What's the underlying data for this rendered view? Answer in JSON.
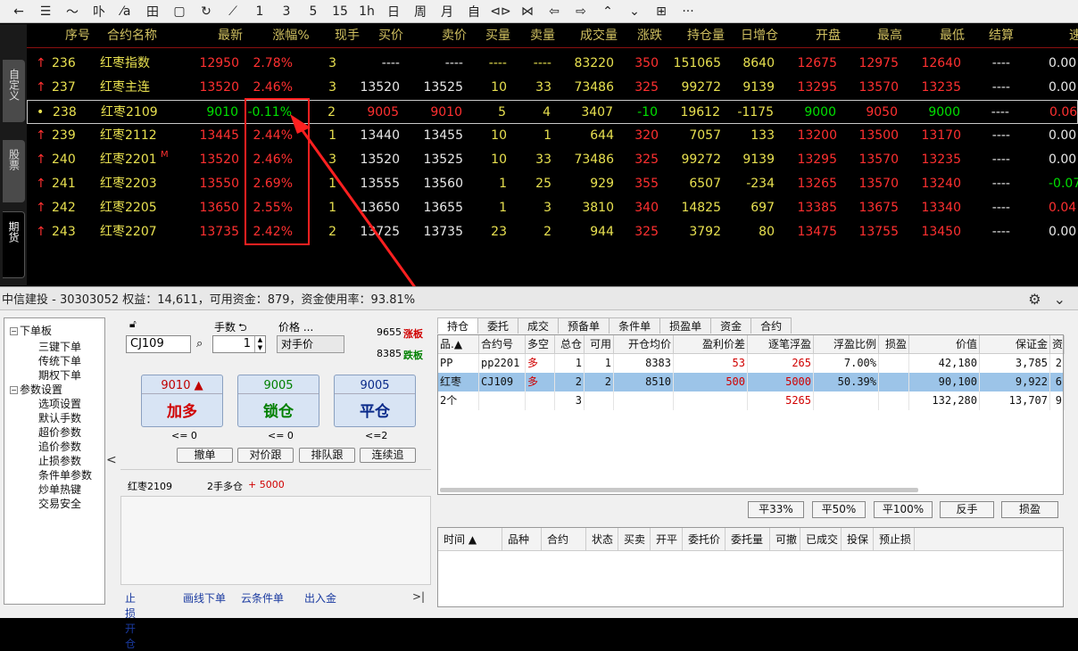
{
  "toolbar": {
    "items": [
      "←",
      "☰",
      "〜",
      "卟",
      "⁄a",
      "田",
      "▢",
      "↻",
      "⟋",
      "1",
      "3",
      "5",
      "15",
      "1h",
      "日",
      "周",
      "月",
      "自",
      "⊲⊳",
      "⋈",
      "⇦",
      "⇨",
      "⌃",
      "⌄",
      "⊞",
      "···"
    ]
  },
  "side_tabs": [
    "自定义",
    "股票",
    "期货"
  ],
  "quote": {
    "headers": [
      "序号",
      "合约名称",
      "最新",
      "涨幅%",
      "现手",
      "买价",
      "卖价",
      "买量",
      "卖量",
      "成交量",
      "涨跌",
      "持仓量",
      "日增仓",
      "开盘",
      "最高",
      "最低",
      "结算",
      "速"
    ],
    "rows": [
      [
        "↑",
        "236",
        "红枣指数",
        "12950",
        "2.78%",
        "3",
        "----",
        "----",
        "----",
        "----",
        "83220",
        "350",
        "151065",
        "8640",
        "12675",
        "12975",
        "12640",
        "----",
        "0.00"
      ],
      [
        "↑",
        "237",
        "红枣主连",
        "13520",
        "2.46%",
        "3",
        "13520",
        "13525",
        "10",
        "33",
        "73486",
        "325",
        "99272",
        "9139",
        "13295",
        "13570",
        "13235",
        "----",
        "0.00"
      ],
      [
        "•",
        "238",
        "红枣2109",
        "9010",
        "-0.11%",
        "2",
        "9005",
        "9010",
        "5",
        "4",
        "3407",
        "-10",
        "19612",
        "-1175",
        "9000",
        "9050",
        "9000",
        "----",
        "0.06"
      ],
      [
        "↑",
        "239",
        "红枣2112",
        "13445",
        "2.44%",
        "1",
        "13440",
        "13455",
        "10",
        "1",
        "644",
        "320",
        "7057",
        "133",
        "13200",
        "13500",
        "13170",
        "----",
        "0.00"
      ],
      [
        "↑",
        "240",
        "红枣2201",
        "13520",
        "2.46%",
        "3",
        "13520",
        "13525",
        "10",
        "33",
        "73486",
        "325",
        "99272",
        "9139",
        "13295",
        "13570",
        "13235",
        "----",
        "0.00"
      ],
      [
        "↑",
        "241",
        "红枣2203",
        "13550",
        "2.69%",
        "1",
        "13555",
        "13560",
        "1",
        "25",
        "929",
        "355",
        "6507",
        "-234",
        "13265",
        "13570",
        "13240",
        "----",
        "-0.07"
      ],
      [
        "↑",
        "242",
        "红枣2205",
        "13650",
        "2.55%",
        "1",
        "13650",
        "13655",
        "1",
        "3",
        "3810",
        "340",
        "14825",
        "697",
        "13385",
        "13675",
        "13340",
        "----",
        "0.04"
      ],
      [
        "↑",
        "243",
        "红枣2207",
        "13735",
        "2.42%",
        "2",
        "13725",
        "13735",
        "23",
        "2",
        "944",
        "325",
        "3792",
        "80",
        "13475",
        "13755",
        "13450",
        "----",
        "0.00"
      ]
    ],
    "row_240_mark": "M"
  },
  "account": {
    "text": "中信建投 - 30303052  权益：14,611，可用资金：879，资金使用率：93.81%"
  },
  "tree": {
    "items": [
      "下单板",
      "三键下单",
      "传统下单",
      "期权下单",
      "参数设置",
      "选项设置",
      "默认手数",
      "超价参数",
      "追价参数",
      "止损参数",
      "条件单参数",
      "炒单热键",
      "交易安全"
    ]
  },
  "order": {
    "code": "CJ109",
    "qty_label": "手数",
    "qty": "1",
    "price_label": "价格 ...",
    "price_mode": "对手价",
    "limit_up": "9655",
    "limit_up_label": "涨板",
    "limit_down": "8385",
    "limit_down_label": "跌板",
    "buttons": [
      {
        "price": "9010",
        "arrow": "▲",
        "label": "加多",
        "note": "<= 0"
      },
      {
        "price": "9005",
        "label": "锁仓",
        "note": "<= 0"
      },
      {
        "price": "9005",
        "label": "平仓",
        "note": "<=2"
      }
    ],
    "small_buttons": [
      "撤单",
      "对价跟",
      "排队跟",
      "连续追"
    ],
    "info_name": "红枣2109",
    "info_pos": "2手多仓",
    "info_pnl": "+ 5000",
    "links": [
      "止损开仓",
      "画线下单",
      "云条件单",
      "出入金"
    ],
    "link_more": ">|",
    "collapse": "<"
  },
  "positions": {
    "tabs": [
      "持仓",
      "委托",
      "成交",
      "预备单",
      "条件单",
      "损盈单",
      "资金",
      "合约"
    ],
    "headers": [
      "品.▲",
      "合约号",
      "多空",
      "总仓",
      "可用",
      "开仓均价",
      "盈利价差",
      "逐笔浮盈",
      "浮盈比例",
      "损盈",
      "价值",
      "保证金",
      "资"
    ],
    "rows": [
      [
        "PP",
        "pp2201",
        "多",
        "1",
        "1",
        "8383",
        "53",
        "265",
        "7.00%",
        "",
        "42,180",
        "3,785",
        "2"
      ],
      [
        "红枣",
        "CJ109",
        "多",
        "2",
        "2",
        "8510",
        "500",
        "5000",
        "50.39%",
        "",
        "90,100",
        "9,922",
        "6"
      ],
      [
        "2个",
        "",
        "",
        "3",
        "",
        "",
        "",
        "5265",
        "",
        "",
        "132,280",
        "13,707",
        "9"
      ]
    ],
    "actions": [
      "平33%",
      "平50%",
      "平100%",
      "反手",
      "损盈"
    ]
  },
  "orders": {
    "headers": [
      "时间 ▲",
      "品种",
      "合约",
      "状态",
      "买卖",
      "开平",
      "委托价",
      "委托量",
      "可撤",
      "已成交",
      "投保",
      "预止损"
    ]
  }
}
